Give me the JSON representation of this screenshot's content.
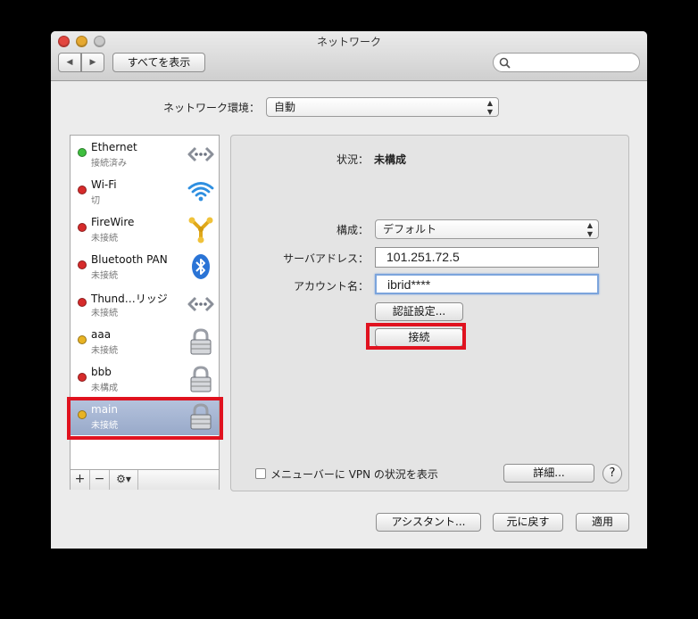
{
  "window": {
    "title": "ネットワーク"
  },
  "toolbar": {
    "back_label": "◀",
    "forward_label": "▶",
    "show_all_label": "すべてを表示",
    "search_placeholder": ""
  },
  "location": {
    "label": "ネットワーク環境：",
    "value": "自動"
  },
  "services": [
    {
      "name": "Ethernet",
      "status": "接続済み",
      "dot_color": "#3fbf3f",
      "icon": "ethernet-icon"
    },
    {
      "name": "Wi-Fi",
      "status": "切",
      "dot_color": "#d62b2b",
      "icon": "wifi-icon"
    },
    {
      "name": "FireWire",
      "status": "未接続",
      "dot_color": "#d62b2b",
      "icon": "firewire-icon"
    },
    {
      "name": "Bluetooth PAN",
      "status": "未接続",
      "dot_color": "#d62b2b",
      "icon": "bluetooth-icon"
    },
    {
      "name": "Thund…リッジ",
      "status": "未接続",
      "dot_color": "#d62b2b",
      "icon": "thunderbolt-bridge-icon"
    },
    {
      "name": "aaa",
      "status": "未接続",
      "dot_color": "#e8b323",
      "icon": "vpn-lock-icon"
    },
    {
      "name": "bbb",
      "status": "未構成",
      "dot_color": "#d62b2b",
      "icon": "vpn-lock-icon"
    },
    {
      "name": "main",
      "status": "未接続",
      "dot_color": "#e8b323",
      "icon": "vpn-lock-icon"
    }
  ],
  "sidebar_buttons": {
    "add": "+",
    "remove": "−",
    "gear": "⚙▾"
  },
  "detail": {
    "status_label": "状況：",
    "status_value": "未構成",
    "config_label": "構成：",
    "config_value": "デフォルト",
    "server_label": "サーバアドレス：",
    "server_value": "101.251.72.5",
    "account_label": "アカウント名：",
    "account_value": "ibrid****",
    "auth_button": "認証設定...",
    "connect_button": "接続",
    "menubar_checkbox_label": "メニューバーに VPN の状況を表示",
    "advanced_button": "詳細...",
    "help_button": "?"
  },
  "footer": {
    "assistant_button": "アシスタント...",
    "revert_button": "元に戻す",
    "apply_button": "適用"
  },
  "colors": {
    "highlight": "#e0121f",
    "selection": "#a3b3d2"
  }
}
